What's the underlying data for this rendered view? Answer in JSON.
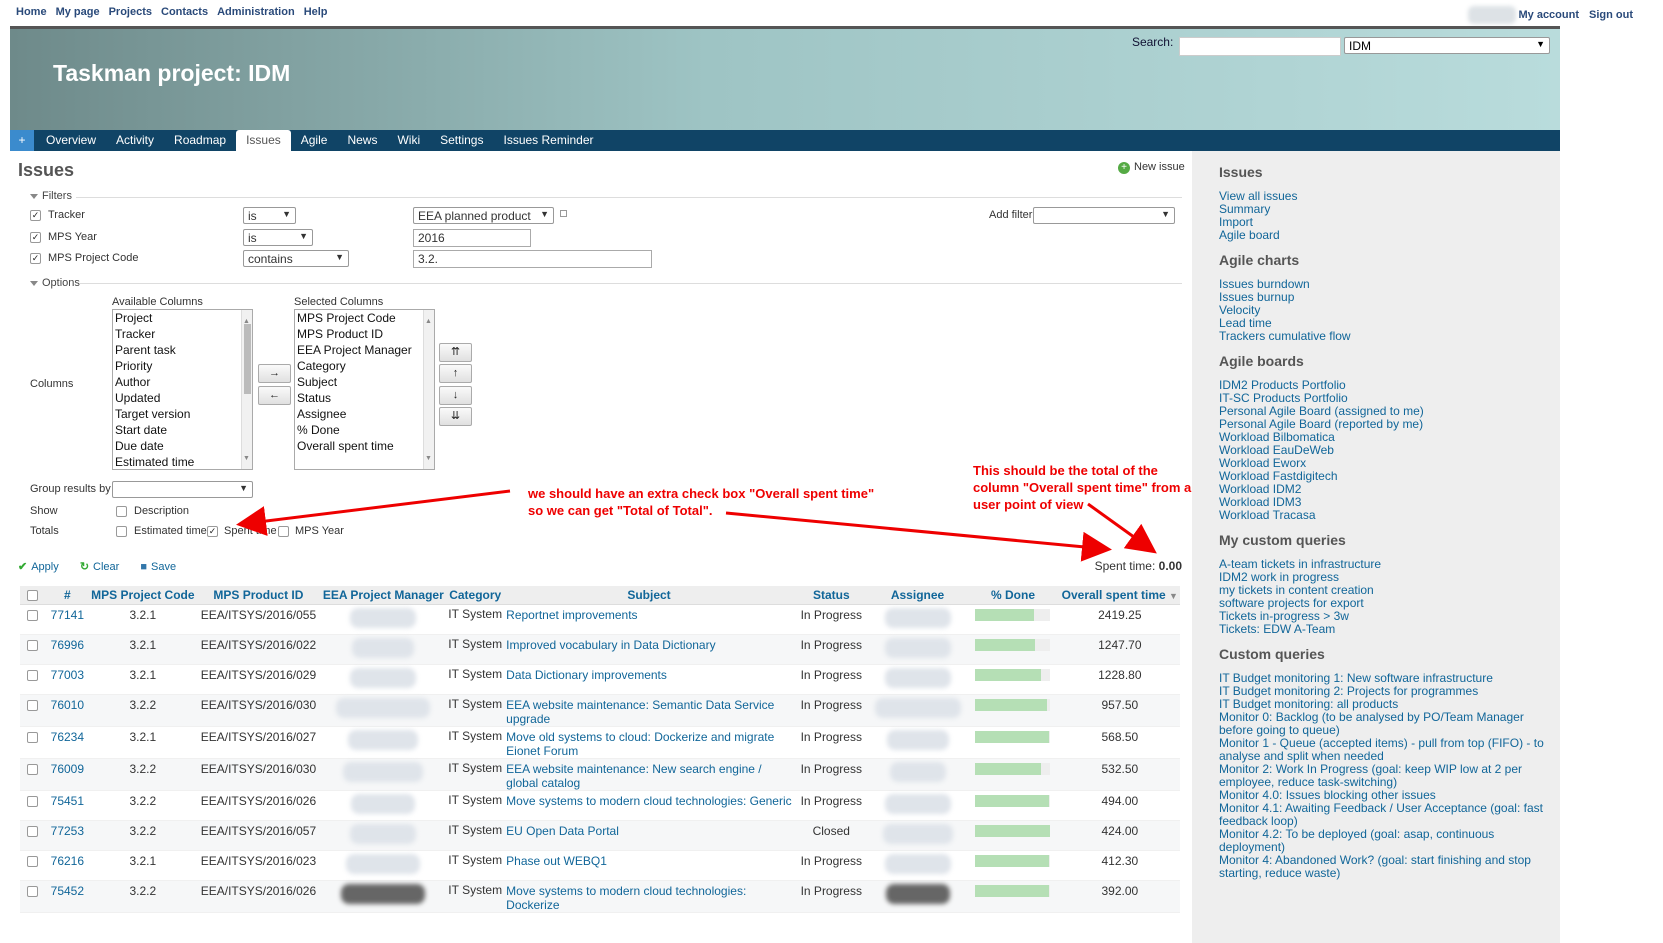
{
  "top_menu": {
    "left": [
      "Home",
      "My page",
      "Projects",
      "Contacts",
      "Administration",
      "Help"
    ],
    "my_account": "My account",
    "sign_out": "Sign out"
  },
  "header": {
    "title": "Taskman project: IDM",
    "search_label": "Search:",
    "project_select": "IDM"
  },
  "main_menu": {
    "plus": "+",
    "tabs": [
      "Overview",
      "Activity",
      "Roadmap",
      "Issues",
      "Agile",
      "News",
      "Wiki",
      "Settings",
      "Issues Reminder"
    ],
    "selected": "Issues"
  },
  "content": {
    "title": "Issues",
    "new_issue": "New issue",
    "filters_legend": "Filters",
    "filters": [
      {
        "label": "Tracker",
        "operator": "is",
        "value": "EEA planned product"
      },
      {
        "label": "MPS Year",
        "operator": "is",
        "value": "2016"
      },
      {
        "label": "MPS Project Code",
        "operator": "contains",
        "value": "3.2."
      }
    ],
    "add_filter_label": "Add filter",
    "options_legend": "Options",
    "columns_label": "Columns",
    "available_columns_label": "Available Columns",
    "available_columns": [
      "Project",
      "Tracker",
      "Parent task",
      "Priority",
      "Author",
      "Updated",
      "Target version",
      "Start date",
      "Due date",
      "Estimated time"
    ],
    "selected_columns_label": "Selected Columns",
    "selected_columns": [
      "MPS Project Code",
      "MPS Product ID",
      "EEA Project Manager",
      "Category",
      "Subject",
      "Status",
      "Assignee",
      "% Done",
      "Overall spent time"
    ],
    "move_right": "→",
    "move_left": "←",
    "move_top": "⇈",
    "move_up": "↑",
    "move_down": "↓",
    "move_bottom": "⇊",
    "group_label": "Group results by",
    "show_label": "Show",
    "show_description": "Description",
    "totals_label": "Totals",
    "totals_options": [
      "Estimated time",
      "Spent time",
      "MPS Year"
    ],
    "apply": "Apply",
    "clear": "Clear",
    "save": "Save",
    "spent_time_label": "Spent time:",
    "spent_time_value": "0.00",
    "annotation_1": "we should have an extra check box \"Overall spent time\" so we can get \"Total of Total\".",
    "annotation_2": "This should be the total of the column \"Overall spent time\" from a user point of view",
    "table": {
      "headers": [
        "#",
        "MPS Project Code",
        "MPS Product ID",
        "EEA Project Manager",
        "Category",
        "Subject",
        "Status",
        "Assignee",
        "% Done",
        "Overall spent time"
      ],
      "rows": [
        {
          "id": "77141",
          "code": "3.2.1",
          "product": "EEA/ITSYS/2016/055",
          "category": "IT System",
          "subject": "Reportnet improvements",
          "status": "In Progress",
          "done": 78,
          "spent": "2419.25"
        },
        {
          "id": "76996",
          "code": "3.2.1",
          "product": "EEA/ITSYS/2016/022",
          "category": "IT System",
          "subject": "Improved vocabulary in Data Dictionary",
          "status": "In Progress",
          "done": 80,
          "spent": "1247.70"
        },
        {
          "id": "77003",
          "code": "3.2.1",
          "product": "EEA/ITSYS/2016/029",
          "category": "IT System",
          "subject": "Data Dictionary improvements",
          "status": "In Progress",
          "done": 88,
          "spent": "1228.80"
        },
        {
          "id": "76010",
          "code": "3.2.2",
          "product": "EEA/ITSYS/2016/030",
          "category": "IT System",
          "subject": "EEA website maintenance: Semantic Data Service upgrade",
          "status": "In Progress",
          "done": 95,
          "spent": "957.50"
        },
        {
          "id": "76234",
          "code": "3.2.1",
          "product": "EEA/ITSYS/2016/027",
          "category": "IT System",
          "subject": "Move old systems to cloud: Dockerize and migrate Eionet Forum",
          "status": "In Progress",
          "done": 98,
          "spent": "568.50"
        },
        {
          "id": "76009",
          "code": "3.2.2",
          "product": "EEA/ITSYS/2016/030",
          "category": "IT System",
          "subject": "EEA website maintenance: New search engine / global catalog",
          "status": "In Progress",
          "done": 88,
          "spent": "532.50"
        },
        {
          "id": "75451",
          "code": "3.2.2",
          "product": "EEA/ITSYS/2016/026",
          "category": "IT System",
          "subject": "Move systems to modern cloud technologies: Generic",
          "status": "In Progress",
          "done": 98,
          "spent": "494.00"
        },
        {
          "id": "77253",
          "code": "3.2.2",
          "product": "EEA/ITSYS/2016/057",
          "category": "IT System",
          "subject": "EU Open Data Portal",
          "status": "Closed",
          "done": 100,
          "spent": "424.00"
        },
        {
          "id": "76216",
          "code": "3.2.1",
          "product": "EEA/ITSYS/2016/023",
          "category": "IT System",
          "subject": "Phase out WEBQ1",
          "status": "In Progress",
          "done": 98,
          "spent": "412.30"
        },
        {
          "id": "75452",
          "code": "3.2.2",
          "product": "EEA/ITSYS/2016/026",
          "category": "IT System",
          "subject": "Move systems to modern cloud technologies: Dockerize",
          "status": "In Progress",
          "done": 98,
          "spent": "392.00"
        }
      ]
    }
  },
  "sidebar": {
    "sections": [
      {
        "title": "Issues",
        "links": [
          "View all issues",
          "Summary",
          "Import",
          "Agile board"
        ]
      },
      {
        "title": "Agile charts",
        "links": [
          "Issues burndown",
          "Issues burnup",
          "Velocity",
          "Lead time",
          "Trackers cumulative flow"
        ]
      },
      {
        "title": "Agile boards",
        "links": [
          "IDM2 Products Portfolio",
          "IT-SC Products Portfolio",
          "Personal Agile Board (assigned to me)",
          "Personal Agile Board (reported by me)",
          "Workload Bilbomatica",
          "Workload EauDeWeb",
          "Workload Eworx",
          "Workload Fastdigitech",
          "Workload IDM2",
          "Workload IDM3",
          "Workload Tracasa"
        ]
      },
      {
        "title": "My custom queries",
        "links": [
          "A-team tickets in infrastructure",
          "IDM2 work in progress",
          "my tickets in content creation",
          "software projects for export",
          "Tickets in-progress > 3w",
          "Tickets: EDW A-Team"
        ]
      },
      {
        "title": "Custom queries",
        "links": [
          "IT Budget monitoring 1: New software infrastructure",
          "IT Budget monitoring 2: Projects for programmes",
          "IT Budget monitoring: all products",
          "Monitor 0: Backlog (to be analysed by PO/Team Manager before going to queue)",
          "Monitor 1 - Queue (accepted items) - pull from top (FIFO) - to analyse and split when needed",
          "Monitor 2: Work In Progress (goal: keep WIP low at 2 per employee, reduce task-switching)",
          "Monitor 4.0: Issues blocking other issues",
          "Monitor 4.1: Awaiting Feedback / User Acceptance (goal: fast feedback loop)",
          "Monitor 4.2: To be deployed (goal: asap, continuous deployment)",
          "Monitor 4: Abandoned Work? (goal: start finishing and stop starting, reduce waste)"
        ]
      }
    ]
  }
}
